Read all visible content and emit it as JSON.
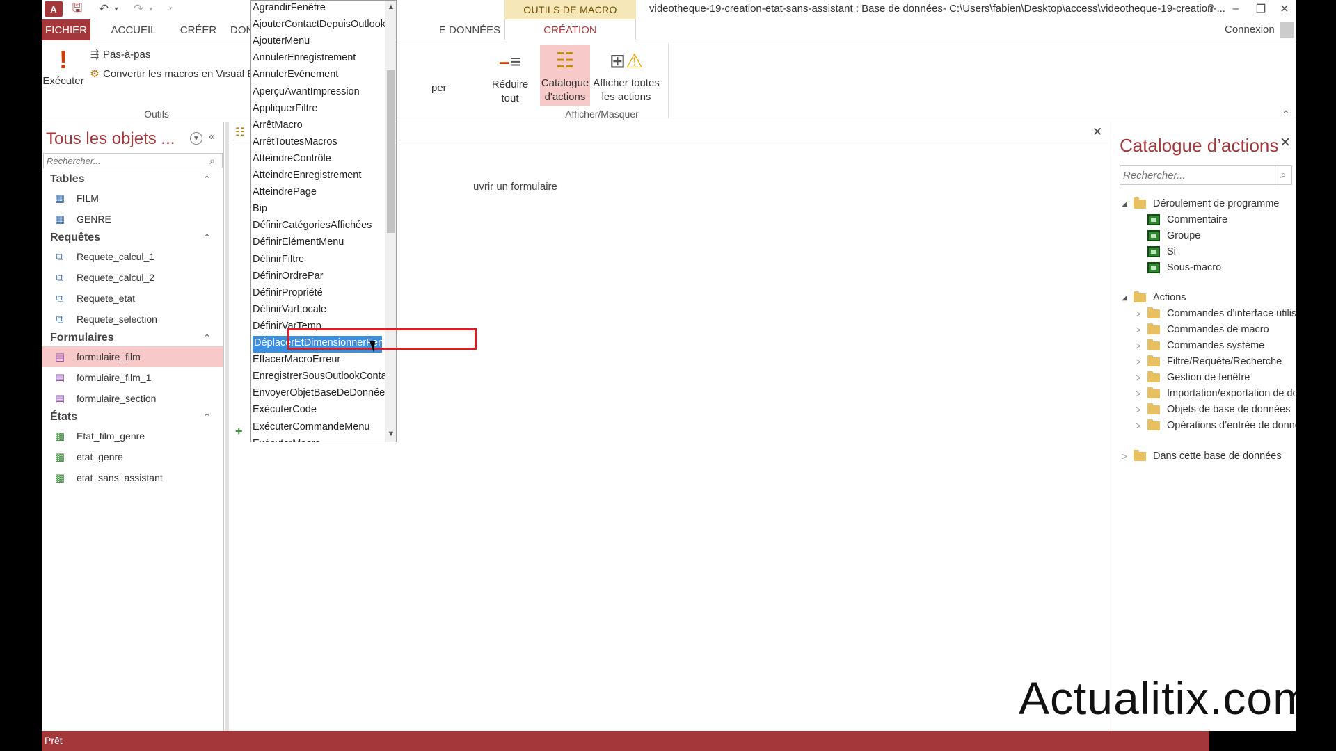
{
  "titlebar": {
    "app_logo": "A",
    "context_tab_group": "OUTILS DE MACRO",
    "window_title": "videotheque-19-creation-etat-sans-assistant : Base de données- C:\\Users\\fabien\\Desktop\\access\\videotheque-19-creation-...",
    "help": "?",
    "minimize": "–",
    "restore": "❐",
    "close": "✕"
  },
  "tabs": {
    "fichier": "FICHIER",
    "accueil": "ACCUEIL",
    "creer": "CRÉER",
    "donnees": "DONN",
    "donnees_ext": "E DONNÉES",
    "creation": "CRÉATION",
    "signin": "Connexion"
  },
  "ribbon": {
    "run_label": "Exécuter",
    "step_label": "Pas-à-pas",
    "convert_label": "Convertir les macros en Visual B",
    "group_outils": "Outils",
    "expand_partial": "per",
    "collapse_all_line1": "Réduire",
    "collapse_all_line2": "tout",
    "catalog_line1": "Catalogue",
    "catalog_line2": "d'actions",
    "show_all_line1": "Afficher toutes",
    "show_all_line2": "les actions",
    "group_afficher": "Afficher/Masquer"
  },
  "nav": {
    "title": "Tous les objets ...",
    "search_placeholder": "Rechercher...",
    "groups": {
      "tables": "Tables",
      "requetes": "Requêtes",
      "formulaires": "Formulaires",
      "etats": "États"
    },
    "tables": [
      "FILM",
      "GENRE"
    ],
    "requetes": [
      "Requete_calcul_1",
      "Requete_calcul_2",
      "Requete_etat",
      "Requete_selection"
    ],
    "formulaires": [
      "formulaire_film",
      "formulaire_film_1",
      "formulaire_section"
    ],
    "etats": [
      "Etat_film_genre",
      "etat_genre",
      "etat_sans_assistant"
    ],
    "selected": "formulaire_film"
  },
  "document": {
    "macro_comment": "uvrir un formulaire",
    "close": "✕"
  },
  "dropdown": {
    "items": [
      "AgrandirFenêtre",
      "AjouterContactDepuisOutlook",
      "AjouterMenu",
      "AnnulerEnregistrement",
      "AnnulerEvénement",
      "AperçuAvantImpression",
      "AppliquerFiltre",
      "ArrêtMacro",
      "ArrêtToutesMacros",
      "AtteindreContrôle",
      "AtteindreEnregistrement",
      "AtteindrePage",
      "Bip",
      "DéfinirCatégoriesAffichées",
      "DéfinirElémentMenu",
      "DéfinirFiltre",
      "DéfinirOrdrePar",
      "DéfinirPropriété",
      "DéfinirVarLocale",
      "DéfinirVarTemp",
      "DéplacerEtDimensionnerFenêtre",
      "EffacerMacroErreur",
      "EnregistrerSousOutlookContact",
      "EnvoyerObjetBaseDeDonnées",
      "ExécuterCode",
      "ExécuterCommandeMenu",
      "ExécuterMacro"
    ],
    "selected_index": 20
  },
  "catalog": {
    "title": "Catalogue d’actions",
    "search_placeholder": "Rechercher...",
    "flow_group": "Déroulement de programme",
    "flow_items": [
      "Commentaire",
      "Groupe",
      "Si",
      "Sous-macro"
    ],
    "actions_group": "Actions",
    "actions_items": [
      "Commandes d’interface utilisateur",
      "Commandes de macro",
      "Commandes système",
      "Filtre/Requête/Recherche",
      "Gestion de fenêtre",
      "Importation/exportation de données",
      "Objets de base de données",
      "Opérations d’entrée de données"
    ],
    "db_group": "Dans cette base de données"
  },
  "status": {
    "text": "Prêt"
  },
  "watermark": "Actualitix.com",
  "colors": {
    "accent": "#a4373a",
    "selection_blue": "#3c8fe0",
    "highlight_red": "#e01a22",
    "selected_nav": "#f7c9c9"
  }
}
